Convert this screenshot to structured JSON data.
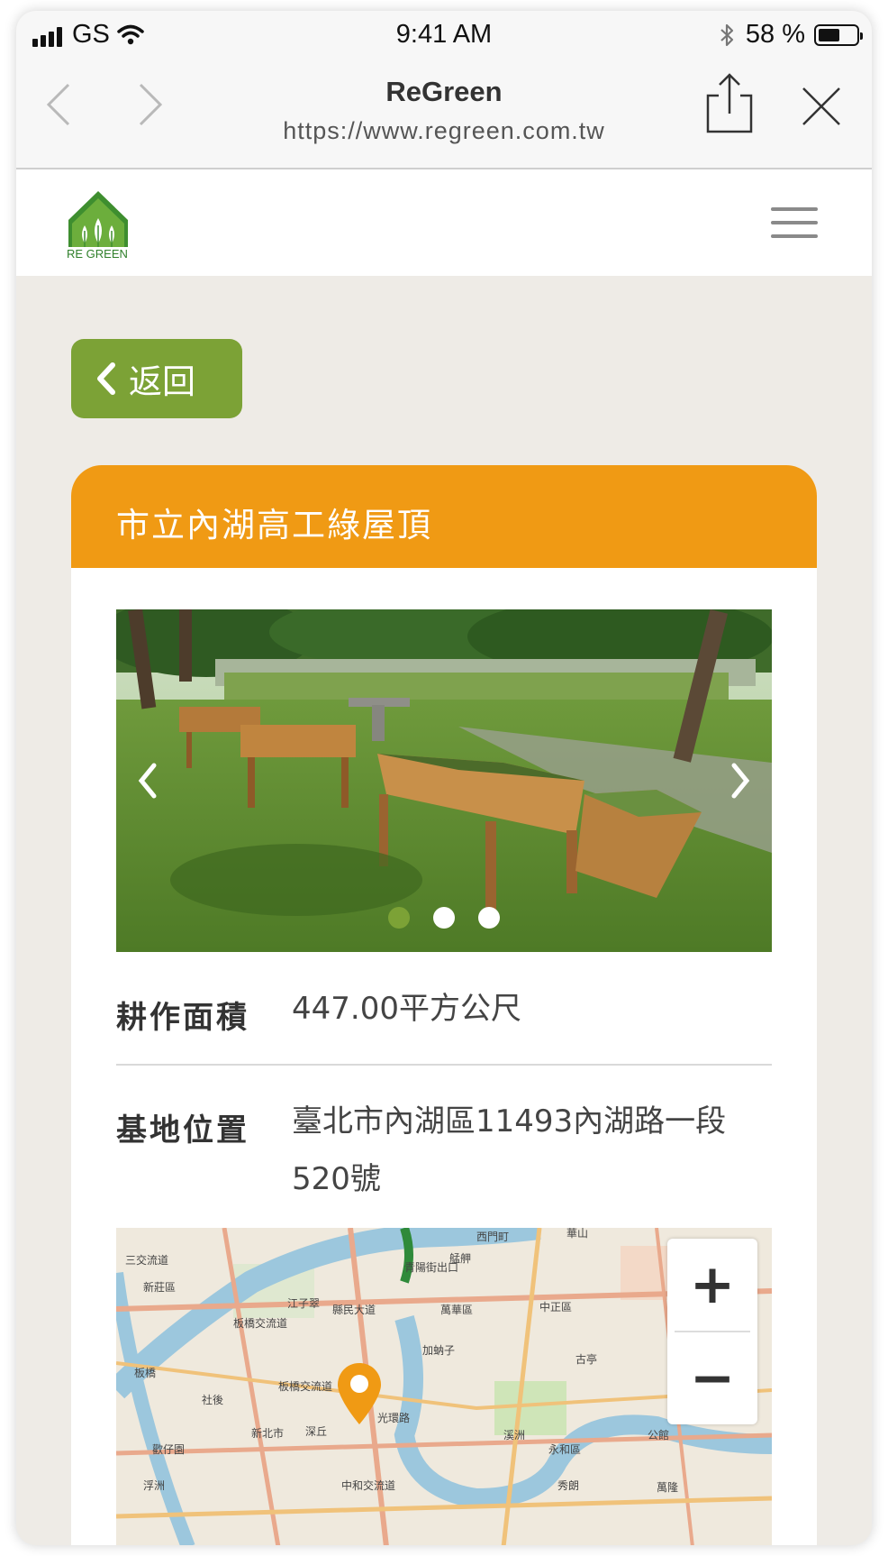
{
  "status_bar": {
    "carrier": "GS",
    "time": "9:41 AM",
    "battery_percent_text": "58 %",
    "battery_level": 0.58
  },
  "browser": {
    "title": "ReGreen",
    "url": "https://www.regreen.com.tw"
  },
  "site": {
    "logo_text": "RE GREEN",
    "back_label": "返回"
  },
  "detail": {
    "title": "市立內湖高工綠屋頂",
    "carousel": {
      "slide_count": 3,
      "active_index": 0
    },
    "area_label": "耕作面積",
    "area_value": "447.00平方公尺",
    "location_label": "基地位置",
    "location_value": "臺北市內湖區11493內湖路一段520號"
  },
  "map": {
    "zoom_in": "+",
    "zoom_out": "−",
    "labels": [
      "三交流道",
      "新莊區",
      "江子翠",
      "板橋交流道",
      "縣民大道",
      "萬華區",
      "西門町",
      "華山",
      "中正區",
      "古亭",
      "新北市",
      "板橋交流道",
      "加蚋子",
      "光環路",
      "溪洲",
      "永和區",
      "公館",
      "秀朗",
      "歡仔園",
      "浮洲",
      "板橋",
      "社後",
      "深丘",
      "中和交流道",
      "萬隆",
      "青陽街出口",
      "艋舺"
    ]
  },
  "colors": {
    "accent_green": "#7ca236",
    "header_orange": "#f09a14",
    "page_bg": "#eeebe6"
  }
}
